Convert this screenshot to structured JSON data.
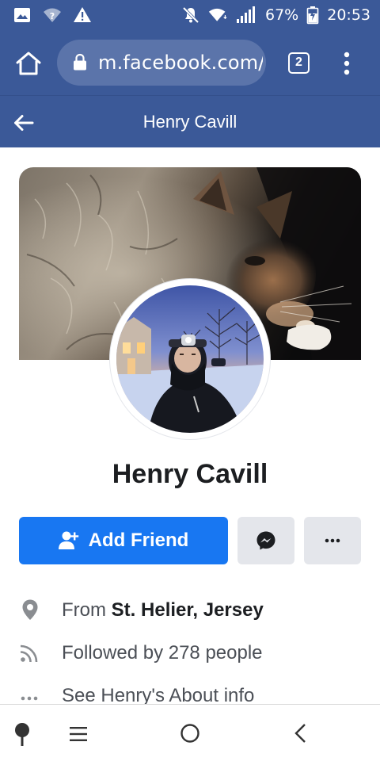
{
  "status_bar": {
    "battery": "67%",
    "time": "20:53",
    "icons": [
      "image-icon",
      "wifi-question-icon",
      "warning-icon",
      "mute-icon",
      "wifi-icon",
      "signal-icon",
      "battery-charging-icon"
    ]
  },
  "browser": {
    "url": "m.facebook.com/p",
    "tab_count": "2",
    "icons": [
      "home-icon",
      "lock-icon",
      "more-vert-icon"
    ]
  },
  "header": {
    "title": "Henry Cavill",
    "icons": [
      "back-arrow-icon"
    ]
  },
  "profile": {
    "name": "Henry Cavill"
  },
  "actions": {
    "add_friend": "Add Friend",
    "icons": [
      "add-friend-icon",
      "messenger-icon",
      "more-horizontal-icon"
    ]
  },
  "intro": {
    "from_prefix": "From ",
    "from_place": "St. Helier, Jersey",
    "followers": "Followed by 278 people",
    "about": "See Henry's About info",
    "icons": [
      "location-pin-icon",
      "rss-feed-icon",
      "dots-icon"
    ]
  },
  "nav_bar": {
    "icons": [
      "pin-icon",
      "menu-icon",
      "home-circle-icon",
      "back-chevron-icon"
    ]
  },
  "colors": {
    "facebook_blue": "#3b5998",
    "primary_button": "#1877f2",
    "secondary_button": "#e4e6eb"
  }
}
